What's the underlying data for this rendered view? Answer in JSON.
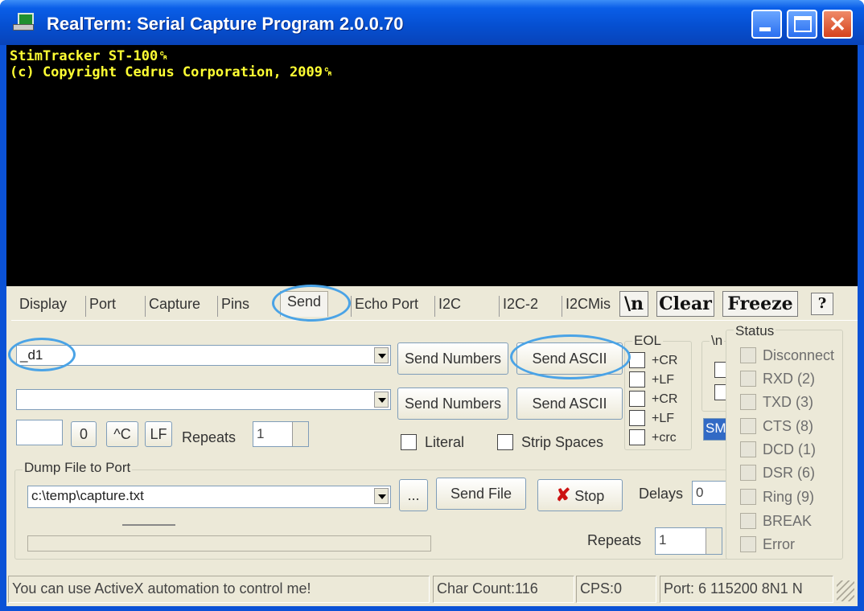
{
  "window": {
    "title": "RealTerm: Serial Capture Program 2.0.0.70",
    "min_label": "",
    "max_label": "",
    "close_label": "✕"
  },
  "terminal": {
    "lines": [
      "StimTracker ST-100␍",
      "(c) Copyright Cedrus Corporation, 2009␍"
    ]
  },
  "tabs": [
    {
      "label": "Display"
    },
    {
      "label": "Port"
    },
    {
      "label": "Capture"
    },
    {
      "label": "Pins"
    },
    {
      "label": "Send",
      "active": true
    },
    {
      "label": "Echo Port"
    },
    {
      "label": "I2C"
    },
    {
      "label": "I2C-2"
    },
    {
      "label": "I2CMis"
    }
  ],
  "toolbar": {
    "newline_label": "\\n",
    "clear_label": "Clear",
    "freeze_label": "Freeze",
    "help_label": "?"
  },
  "send": {
    "line1_value": "_d1",
    "line2_value": "",
    "send_numbers_label": "Send Numbers",
    "send_ascii_label": "Send ASCII",
    "number_value": "",
    "zero_label": "0",
    "ctrl_c_label": "^C",
    "lf_label": "LF",
    "repeats_label": "Repeats",
    "repeats_value": "1",
    "literal_label": "Literal",
    "strip_spaces_label": "Strip Spaces"
  },
  "eol": {
    "title": "EOL",
    "labels": [
      "+CR",
      "+LF",
      "+CR",
      "+LF",
      "+crc"
    ]
  },
  "after": {
    "title": "\\n",
    "selected_value": "SM"
  },
  "dump": {
    "title": "Dump File to Port",
    "file_value": "c:\\temp\\capture.txt",
    "browse_label": "...",
    "send_file_label": "Send File",
    "stop_icon": "✘",
    "stop_label": "Stop",
    "delays_label": "Delays",
    "delays_value": "0",
    "repeats_label": "Repeats",
    "repeats_value": "1"
  },
  "status": {
    "title": "Status",
    "items": [
      "Disconnect",
      "RXD (2)",
      "TXD (3)",
      "CTS (8)",
      "DCD (1)",
      "DSR (6)",
      "Ring (9)",
      "BREAK",
      "Error"
    ]
  },
  "statusbar": {
    "message": "You can use ActiveX automation to control me!",
    "char_count": "Char Count:116",
    "cps": "CPS:0",
    "port": "Port: 6 115200 8N1 N"
  },
  "colors": {
    "titlebar": "#0650d2",
    "terminal_bg": "#000000",
    "terminal_text": "#ffff33",
    "highlight": "#4aa3e6",
    "client_bg": "#ece9d8"
  }
}
